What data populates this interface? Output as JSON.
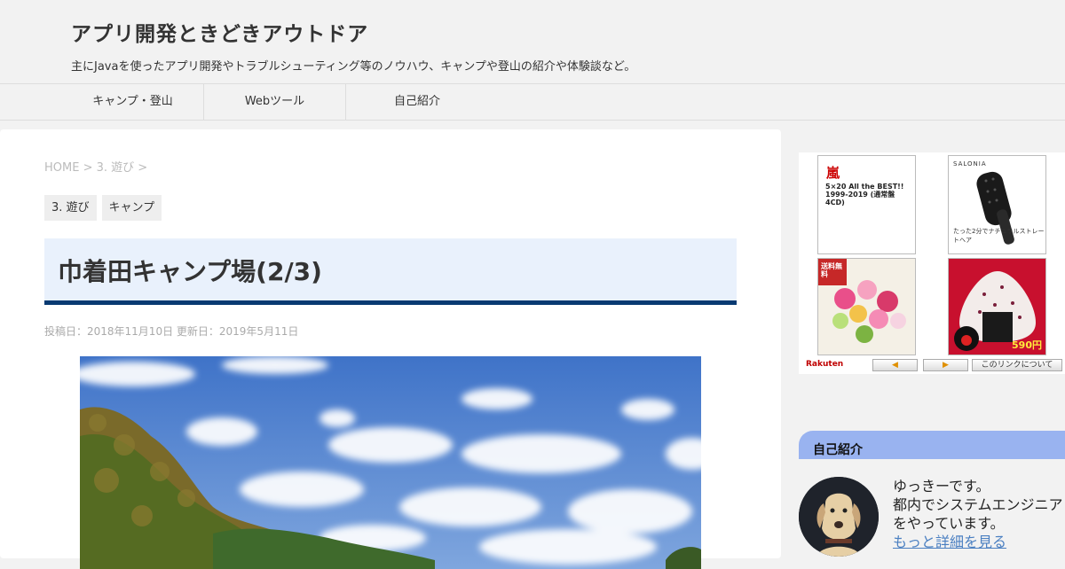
{
  "site": {
    "title": "アプリ開発ときどきアウトドア",
    "description": "主にJavaを使ったアプリ開発やトラブルシューティング等のノウハウ、キャンプや登山の紹介や体験談など。"
  },
  "nav": {
    "items": [
      {
        "label": "キャンプ・登山"
      },
      {
        "label": "Webツール"
      },
      {
        "label": "自己紹介"
      }
    ]
  },
  "breadcrumb": {
    "home": "HOME",
    "sep1": " > ",
    "category": "3. 遊び",
    "sep2": " >"
  },
  "categories": [
    "3. 遊び",
    "キャンプ"
  ],
  "post": {
    "title": "巾着田キャンプ場(2/3)",
    "dates": "投稿日：2018年11月10日 更新日：2019年5月11日"
  },
  "ad": {
    "tile1_kanji": "嵐",
    "tile1_text": "5×20 All the BEST!! 1999-2019 (通常盤 4CD)",
    "tile2_brand": "SALONIA",
    "tile2_text": "たった2分でナチュラルストレートヘア",
    "tile3_text": "送料無料",
    "tile4_text": "590円",
    "rakuten": "Rakuten",
    "prev": "◀",
    "next": "▶",
    "about": "このリンクについて"
  },
  "profile": {
    "heading": "自己紹介",
    "line1": "ゆっきーです。",
    "line2": "都内でシステムエンジニア",
    "line3": "をやっています。",
    "link": "もっと詳細を見る"
  }
}
